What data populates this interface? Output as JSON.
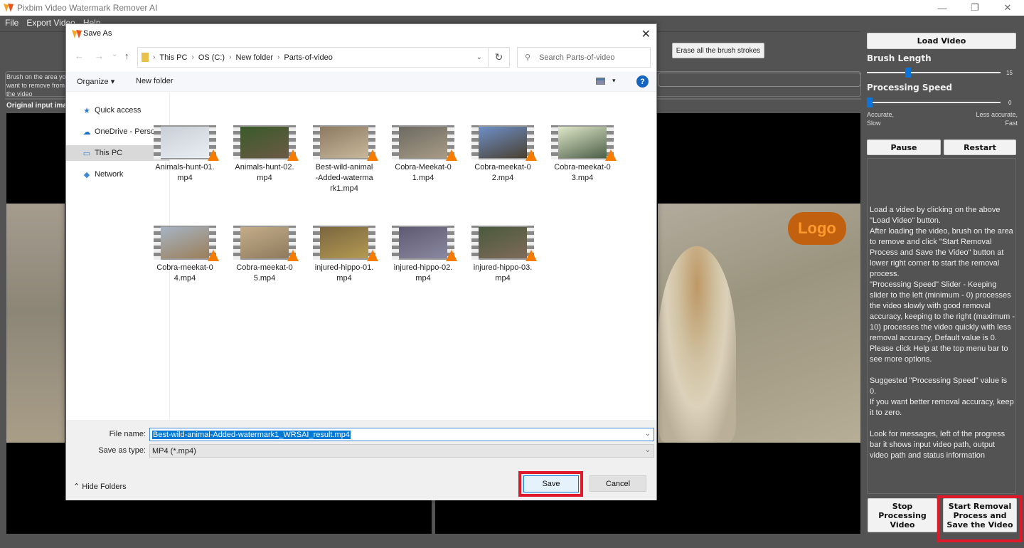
{
  "app": {
    "title": "Pixbim Video Watermark Remover AI",
    "window_controls": {
      "minimize": "—",
      "maximize": "❐",
      "close": "✕"
    },
    "menu": [
      "File",
      "Export Video",
      "Help"
    ]
  },
  "main": {
    "erase_button": "Erase all the brush strokes",
    "message_text": "Brush on the area you want to remove from the video",
    "original_label": "Original input image",
    "watermark_text": "Logo"
  },
  "right_panel": {
    "load_video": "Load Video",
    "brush_length_label": "Brush Length",
    "brush_length_value": 15,
    "brush_length_range": [
      0,
      50
    ],
    "processing_speed_label": "Processing Speed",
    "processing_speed_value": 0,
    "processing_speed_range": [
      0,
      10
    ],
    "speed_left_label": "Accurate,\nSlow",
    "speed_right_label": "Less accurate,\nFast",
    "pause": "Pause",
    "restart": "Restart",
    "info_text": "Load a video by clicking on the above \"Load Video\" button.\nAfter loading the video, brush on the area to remove and click \"Start Removal Process and Save the Video\" button at lower right corner to start the removal process.\n\"Processing Speed\" Slider - Keeping slider to the left (minimum - 0) processes the video slowly with good removal accuracy, keeping to the right (maximum - 10) processes the video quickly with less removal accuracy, Default value is 0.\nPlease click Help at the top menu bar to see more options.\n\nSuggested \"Processing Speed\" value is 0.\nIf you want better removal accuracy, keep it to zero.\n\nLook for messages, left of the progress bar it shows input video path, output video path and status information",
    "stop_button": "Stop Processing Video",
    "start_button": "Start Removal Process and Save the Video"
  },
  "dialog": {
    "title": "Save As",
    "close": "✕",
    "nav": {
      "back": "←",
      "forward": "→",
      "recent": "⌄",
      "up": "↑"
    },
    "breadcrumb": [
      "This PC",
      "OS (C:)",
      "New folder",
      "Parts-of-video"
    ],
    "refresh": "↻",
    "search_placeholder": "Search Parts-of-video",
    "toolbar": {
      "organize": "Organize ▾",
      "new_folder": "New folder",
      "view": "▾",
      "help": "?"
    },
    "nav_pane": [
      {
        "label": "Quick access",
        "icon": "★",
        "color": "#2b78d6"
      },
      {
        "label": "OneDrive - Personal",
        "icon": "☁",
        "color": "#1e6fc7"
      },
      {
        "label": "This PC",
        "icon": "▭",
        "color": "#3a8ad6",
        "selected": true
      },
      {
        "label": "Network",
        "icon": "◆",
        "color": "#3a8ad6"
      }
    ],
    "files": [
      {
        "name": "Animals-hunt-01.\nmp4",
        "c1": "#c9cfd6",
        "c2": "#e9eef3"
      },
      {
        "name": "Animals-hunt-02.\nmp4",
        "c1": "#3a5a2a",
        "c2": "#6b5a45"
      },
      {
        "name": "Best-wild-animal\n-Added-waterma\nrk1.mp4",
        "c1": "#8c7a62",
        "c2": "#c8b89a"
      },
      {
        "name": "Cobra-Meekat-0\n1.mp4",
        "c1": "#6c6a62",
        "c2": "#a89b85"
      },
      {
        "name": "Cobra-meekat-0\n2.mp4",
        "c1": "#6e8fc8",
        "c2": "#4a4030"
      },
      {
        "name": "Cobra-meekat-0\n3.mp4",
        "c1": "#dfe7c8",
        "c2": "#4c5f48"
      },
      {
        "name": "Cobra-meekat-0\n4.mp4",
        "c1": "#a6b4c4",
        "c2": "#9b7e58"
      },
      {
        "name": "Cobra-meekat-0\n5.mp4",
        "c1": "#c3ad8a",
        "c2": "#8e7a5c"
      },
      {
        "name": "injured-hippo-01.\nmp4",
        "c1": "#7a6640",
        "c2": "#b49a52"
      },
      {
        "name": "injured-hippo-02.\nmp4",
        "c1": "#5e5a72",
        "c2": "#8a88a0"
      },
      {
        "name": "injured-hippo-03.\nmp4",
        "c1": "#4a5a3c",
        "c2": "#7e6a5a"
      }
    ],
    "file_name_label": "File name:",
    "file_name_value": "Best-wild-animal-Added-watermark1_WRSAI_result.mp4",
    "save_type_label": "Save as type:",
    "save_type_value": "MP4 (*.mp4)",
    "hide_folders": "Hide Folders",
    "save": "Save",
    "cancel": "Cancel"
  },
  "colors": {
    "accent": "#0a74da",
    "highlight": "#e0192a",
    "background": "#535353"
  }
}
